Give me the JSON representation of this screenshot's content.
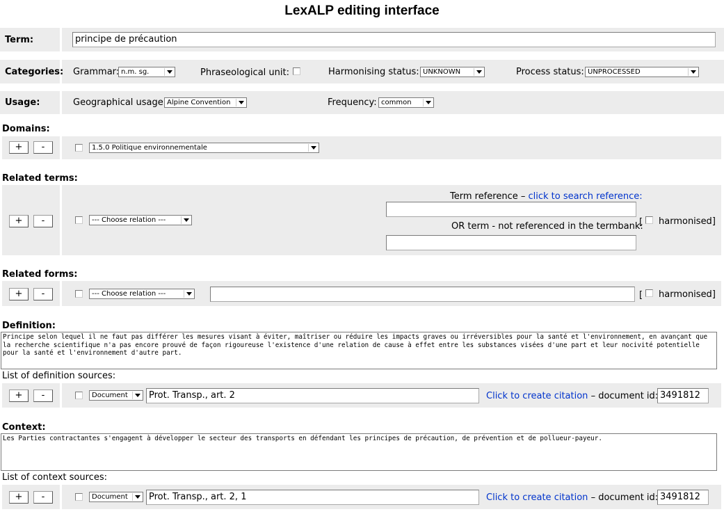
{
  "title": "LexALP editing interface",
  "term": {
    "label": "Term:",
    "value": "principe de précaution"
  },
  "categories": {
    "label": "Categories:",
    "grammar_label": "Grammar:",
    "grammar_value": "n.m. sg.",
    "phraseological_label": "Phraseological unit:",
    "harmonising_label": "Harmonising status:",
    "harmonising_value": "UNKNOWN",
    "process_label": "Process status:",
    "process_value": "UNPROCESSED"
  },
  "usage": {
    "label": "Usage:",
    "geo_label": "Geographical usage:",
    "geo_value": "Alpine Convention",
    "frequency_label": "Frequency:",
    "frequency_value": "common"
  },
  "buttons": {
    "plus": "+",
    "minus": "-"
  },
  "domains": {
    "label": "Domains:",
    "value": "1.5.0 Politique environnementale"
  },
  "related_terms": {
    "label": "Related terms:",
    "relation_value": "--- Choose relation ---",
    "term_ref_label": "Term reference –",
    "term_ref_link": "click to search reference:",
    "or_term_label": "OR term - not referenced in the termbank:",
    "bracket_open": "[",
    "harmonised_label": "harmonised]"
  },
  "related_forms": {
    "label": "Related forms:",
    "relation_value": "--- Choose relation ---",
    "bracket_open": "[",
    "harmonised_label": "harmonised]"
  },
  "definition": {
    "label": "Definition:",
    "text": "Principe selon lequel il ne faut pas différer les mesures visant à éviter, maîtriser ou réduire les impacts graves ou irréversibles pour la santé et l'environnement, en avançant que la recherche scientifique n'a pas encore prouvé de façon rigoureuse l'existence d'une relation de cause à effet entre les substances visées d'une part et leur nocivité potentielle pour la santé et l'environnement d'autre part."
  },
  "definition_sources": {
    "label": "List of definition sources:",
    "type_value": "Document",
    "source_value": "Prot. Transp., art. 2",
    "citation_link": "Click to create citation",
    "docid_label": "– document id:",
    "docid_value": "3491812"
  },
  "context": {
    "label": "Context:",
    "text": "Les Parties contractantes s'engagent à développer le secteur des transports en défendant les principes de précaution, de prévention et de pollueur-payeur."
  },
  "context_sources": {
    "label": "List of context sources:",
    "type_value": "Document",
    "source_value": "Prot. Transp., art. 2, 1",
    "citation_link": "Click to create citation",
    "docid_label": "– document id:",
    "docid_value": "3491812"
  }
}
